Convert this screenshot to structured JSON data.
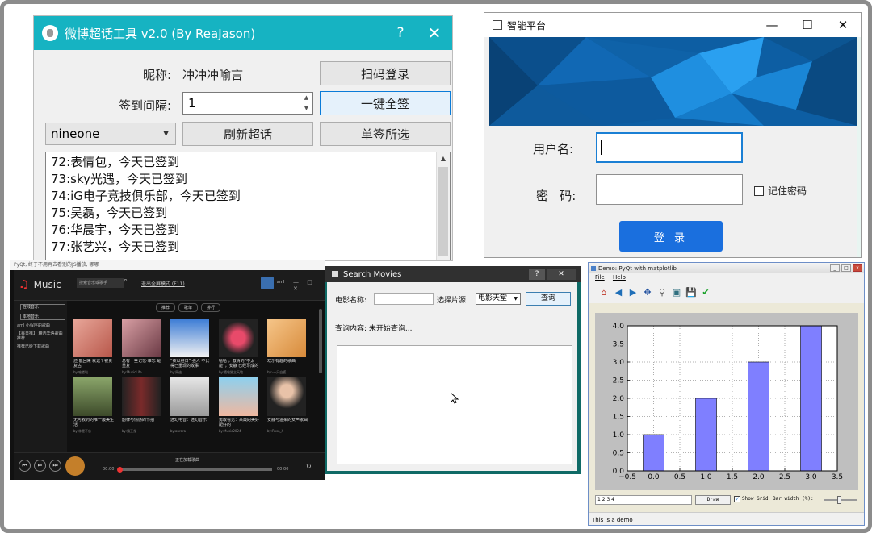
{
  "weibo_tool": {
    "title": "微博超话工具 v2.0  (By ReaJason)",
    "help": "?",
    "close": "✕",
    "nickname_label": "昵称:",
    "nickname_value": "冲冲冲喻言",
    "scan_login": "扫码登录",
    "interval_label": "签到间隔:",
    "interval_value": "1",
    "sign_all": "一键全签",
    "account_select": "nineone",
    "refresh": "刷新超话",
    "sign_selected": "单签所选",
    "log_lines": [
      "72:表情包，今天已签到",
      "73:sky光遇，今天已签到",
      "74:iG电子竞技俱乐部，今天已签到",
      "75:吴磊，今天已签到",
      "76:华晨宇，今天已签到",
      "77:张艺兴，今天已签到"
    ]
  },
  "login_window": {
    "title": "智能平台",
    "minimize": "—",
    "maximize": "☐",
    "close": "✕",
    "username_label": "用户名:",
    "password_label": "密   码:",
    "remember": "记住密码",
    "login_button": "登 录",
    "colors": {
      "banner": "#0d5ea3",
      "button": "#1a6fde"
    }
  },
  "music_player": {
    "caption": "PyQt, 终于不用再去看别的JS播放, 哪哪",
    "logo": "Music",
    "search_placeholder": "搜索音乐或歌手",
    "mode_link": "退出全屏模式 (F11)",
    "user_name": "aml",
    "window_controls": "— □ ✕",
    "sidebar_items": [
      "在线音乐",
      "本地音乐"
    ],
    "sidebar_text": [
      "aml 小程序的歌曲",
      "【每日推】 精选华语歌曲推荐",
      "推荐已经下载歌曲"
    ],
    "tabs": [
      "推荐",
      "歌单",
      "排行"
    ],
    "cards": [
      {
        "caption": "还 能回来 就这个被贵复古",
        "by": "by:哈喽啦"
      },
      {
        "caption": "总有一些记忆·难忘 是重复",
        "by": "by:MusicLife"
      },
      {
        "caption": "“夜以继日”·强人 不比 得已重现的故事",
        "by": "by:周迪"
      },
      {
        "caption": "嘻哈 ，激情的“不太能”，安静 已经写成的",
        "by": "by:嘻哈独立天地"
      },
      {
        "caption": "欢乐有趣的歌曲",
        "by": "by:·一只白狐"
      },
      {
        "caption": "无可救药的唯一最美生活",
        "by": "by:林是不忘"
      },
      {
        "caption": "韵律与情感的节拍",
        "by": "by:霸王龙"
      },
      {
        "caption": "迷幻电音：迷幻音乐",
        "by": "by:aurora"
      },
      {
        "caption": "勇敢看见：来最的美好配好的",
        "by": "by:Music2024"
      },
      {
        "caption": "安静与温柔的女声歌曲",
        "by": "by:Rosa_X"
      }
    ],
    "now_playing": "——正在加载歌曲——",
    "time_start": "00:00",
    "time_end": "00:00",
    "controls": [
      "⏮",
      "⏯",
      "⏭"
    ]
  },
  "search_movies": {
    "title": "Search Movies",
    "help": "?",
    "close": "✕",
    "movie_name_label": "电影名称:",
    "source_label": "选择片源:",
    "source_value": "电影天堂",
    "query_button": "查询",
    "status_label": "查询内容: 未开始查询..."
  },
  "mpl_demo": {
    "title": "Demo: PyQt with matplotlib",
    "menu": [
      "File",
      "Help"
    ],
    "toolbar_icons": [
      "home-icon",
      "back-icon",
      "forward-icon",
      "pan-icon",
      "zoom-icon",
      "subplots-icon",
      "save-icon",
      "check-icon"
    ],
    "toolbar_glyphs": [
      "⌂",
      "◀",
      "▶",
      "✥",
      "⚲",
      "▣",
      "💾",
      "✔"
    ],
    "text_input": "1 2 3 4",
    "draw_button": "Draw",
    "show_grid": "Show Grid",
    "bar_width_label": "Bar width (%):",
    "status": "This is a demo"
  },
  "chart_data": {
    "type": "bar",
    "categories": [
      0,
      1,
      2,
      3
    ],
    "values": [
      1,
      2,
      3,
      4
    ],
    "xlim": [
      -0.5,
      3.5
    ],
    "ylim": [
      0.0,
      4.0
    ],
    "xticks": [
      "−0.5",
      "0.0",
      "0.5",
      "1.0",
      "1.5",
      "2.0",
      "2.5",
      "3.0",
      "3.5"
    ],
    "yticks": [
      "0.0",
      "0.5",
      "1.0",
      "1.5",
      "2.0",
      "2.5",
      "3.0",
      "3.5",
      "4.0"
    ],
    "grid": true,
    "bar_width": 0.4,
    "bar_color": "#7f7fff"
  }
}
